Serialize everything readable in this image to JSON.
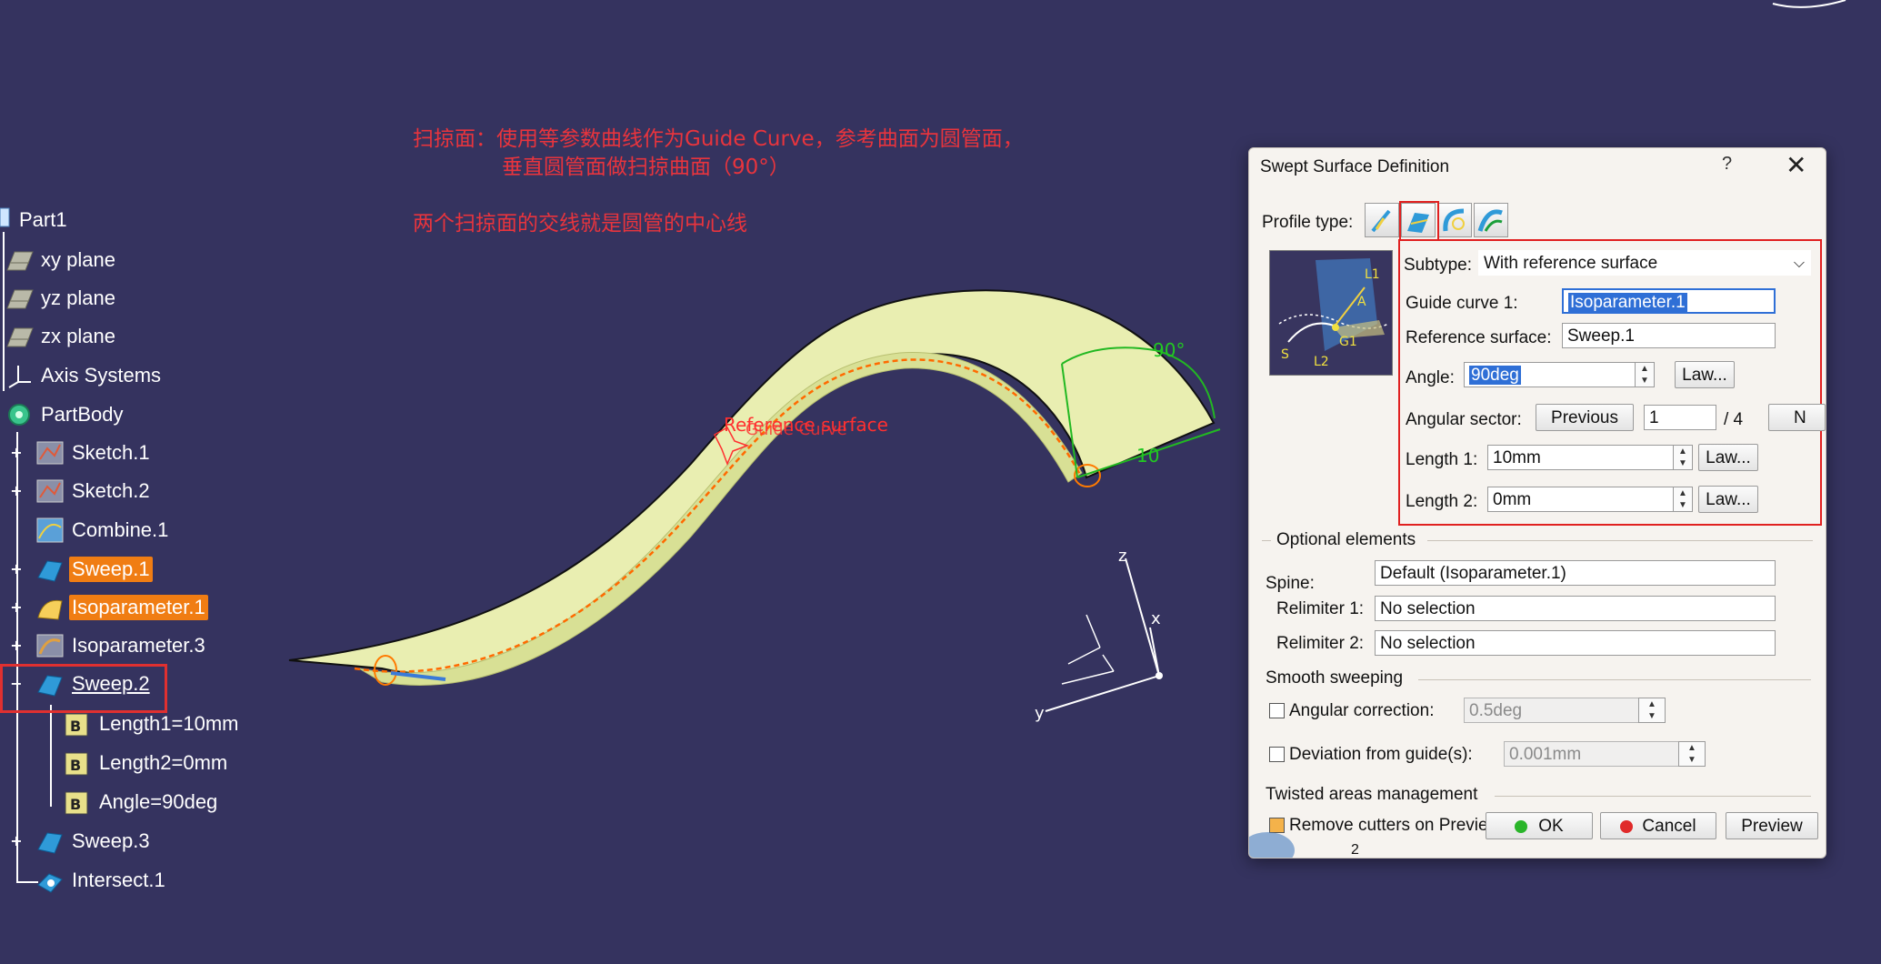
{
  "annotations": {
    "line1": "扫掠面：使用等参数曲线作为Guide Curve，参考曲面为圆管面，",
    "line2": "垂直圆管面做扫掠曲面（90°）",
    "line3": "两个扫掠面的交线就是圆管的中心线"
  },
  "tree": {
    "items": [
      {
        "label": "Part1",
        "icon": "part-icon"
      },
      {
        "label": "xy plane",
        "icon": "plane-icon"
      },
      {
        "label": "yz plane",
        "icon": "plane-icon"
      },
      {
        "label": "zx plane",
        "icon": "plane-icon"
      },
      {
        "label": "Axis Systems",
        "icon": "axis-icon"
      },
      {
        "label": "PartBody",
        "icon": "body-icon"
      },
      {
        "label": "Sketch.1",
        "icon": "sketch-icon"
      },
      {
        "label": "Sketch.2",
        "icon": "sketch-icon"
      },
      {
        "label": "Combine.1",
        "icon": "combine-icon"
      },
      {
        "label": "Sweep.1",
        "icon": "sweep-icon"
      },
      {
        "label": "Isoparameter.1",
        "icon": "isoparameter-icon"
      },
      {
        "label": "Isoparameter.3",
        "icon": "isoparameter-icon"
      },
      {
        "label": "Sweep.2",
        "icon": "sweep-icon"
      },
      {
        "label": "Length1=10mm",
        "icon": "parameter-icon"
      },
      {
        "label": "Length2=0mm",
        "icon": "parameter-icon"
      },
      {
        "label": "Angle=90deg",
        "icon": "parameter-icon"
      },
      {
        "label": "Sweep.3",
        "icon": "sweep-icon"
      },
      {
        "label": "Intersect.1",
        "icon": "intersect-icon"
      }
    ]
  },
  "viewport": {
    "reference_surface_label": "Reference surface",
    "guide_curve_label": "Guide Curve",
    "angle_label": "90°",
    "length_label": "10",
    "axis_x": "x",
    "axis_y": "y",
    "axis_z": "z"
  },
  "dialog": {
    "title": "Swept Surface Definition",
    "help": "?",
    "close": "✕",
    "profile_type_label": "Profile type:",
    "subtype_label": "Subtype:",
    "subtype_value": "With reference surface",
    "guide_curve_label": "Guide curve 1:",
    "guide_curve_value": "Isoparameter.1",
    "reference_surface_label": "Reference surface:",
    "reference_surface_value": "Sweep.1",
    "angle_label": "Angle:",
    "angle_value": "90deg",
    "law_label": "Law...",
    "angular_sector_label": "Angular sector:",
    "previous_label": "Previous",
    "sector_value": "1",
    "sector_total": "/ 4",
    "next_label": "N",
    "length1_label": "Length 1:",
    "length1_value": "10mm",
    "length2_label": "Length 2:",
    "length2_value": "0mm",
    "optional_elements_label": "Optional elements",
    "spine_label": "Spine:",
    "spine_value": "Default (Isoparameter.1)",
    "relimiter1_label": "Relimiter 1:",
    "relimiter1_value": "No selection",
    "relimiter2_label": "Relimiter 2:",
    "relimiter2_value": "No selection",
    "smooth_sweeping_label": "Smooth sweeping",
    "angular_correction_label": "Angular correction:",
    "angular_correction_value": "0.5deg",
    "deviation_label": "Deviation from guide(s):",
    "deviation_value": "0.001mm",
    "twisted_label": "Twisted areas management",
    "remove_cutters_label": "Remove cutters on Preview",
    "bottom_num": "2",
    "ok_label": "OK",
    "cancel_label": "Cancel",
    "preview_label": "Preview",
    "diagram_labels": {
      "l1": "L1",
      "a": "A",
      "s": "S",
      "g1": "G1",
      "l2": "L2"
    }
  }
}
